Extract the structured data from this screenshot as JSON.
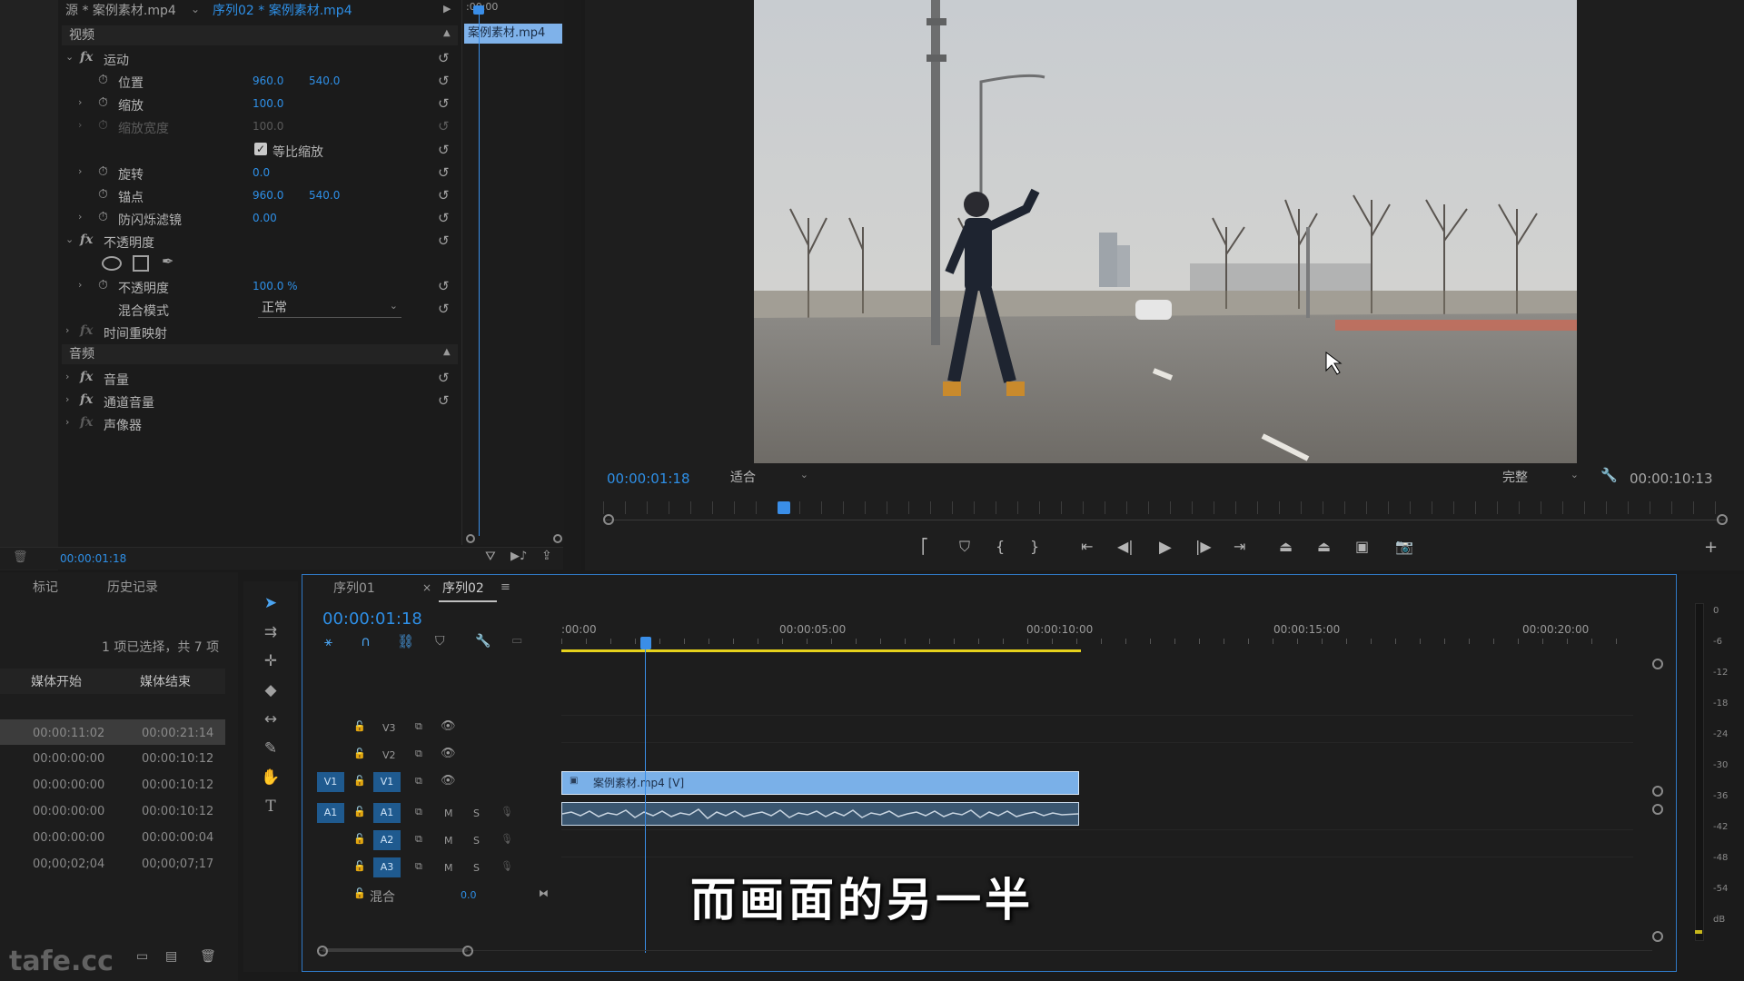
{
  "source_tab": {
    "label": "源 * 案例素材.mp4",
    "sequence_label": "序列02 * 案例素材.mp4",
    "mini_clip": "案例素材.mp4",
    "mini_time": ":00:00"
  },
  "effects": {
    "video_header": "视频",
    "motion": "运动",
    "position": {
      "label": "位置",
      "x": "960.0",
      "y": "540.0"
    },
    "scale": {
      "label": "缩放",
      "value": "100.0"
    },
    "scale_width": {
      "label": "缩放宽度",
      "value": "100.0"
    },
    "uniform_scale": "等比缩放",
    "rotation": {
      "label": "旋转",
      "value": "0.0"
    },
    "anchor": {
      "label": "锚点",
      "x": "960.0",
      "y": "540.0"
    },
    "antiflicker": {
      "label": "防闪烁滤镜",
      "value": "0.00"
    },
    "opacity_group": "不透明度",
    "opacity": {
      "label": "不透明度",
      "value": "100.0 %"
    },
    "blend_mode": {
      "label": "混合模式",
      "value": "正常"
    },
    "time_remap": "时间重映射",
    "audio_header": "音频",
    "volume": "音量",
    "channel_volume": "通道音量",
    "panner": "声像器",
    "timecode": "00:00:01:18"
  },
  "program": {
    "timecode": "00:00:01:18",
    "fit": "适合",
    "quality": "完整",
    "duration": "00:00:10:13"
  },
  "project": {
    "tab_markers": "标记",
    "tab_history": "历史记录",
    "selection_info": "1 项已选择，共 7 项",
    "col_start": "媒体开始",
    "col_end": "媒体结束",
    "rows": [
      {
        "start": "00:00:11:02",
        "end": "00:00:21:14"
      },
      {
        "start": "00:00:00:00",
        "end": "00:00:10:12"
      },
      {
        "start": "00:00:00:00",
        "end": "00:00:10:12"
      },
      {
        "start": "00:00:00:00",
        "end": "00:00:10:12"
      },
      {
        "start": "00:00:00:00",
        "end": "00:00:00:04"
      },
      {
        "start": "00;00;02;04",
        "end": "00;00;07;17"
      }
    ],
    "watermark": "tafe.cc"
  },
  "timeline": {
    "tab1": "序列01",
    "tab2": "序列02",
    "timecode": "00:00:01:18",
    "ruler": [
      ":00:00",
      "00:00:05:00",
      "00:00:10:00",
      "00:00:15:00",
      "00:00:20:00"
    ],
    "tracks_video": [
      "V3",
      "V2",
      "V1"
    ],
    "tracks_audio": [
      "A1",
      "A2",
      "A3"
    ],
    "source_v": "V1",
    "source_a": "A1",
    "mix_label": "混合",
    "mix_value": "0.0",
    "clip_video": "案例素材.mp4 [V]",
    "mute": "M",
    "solo": "S"
  },
  "meter": {
    "scale": [
      "0",
      "-6",
      "-12",
      "-18",
      "-24",
      "-30",
      "-36",
      "-42",
      "-48",
      "-54",
      "dB"
    ]
  },
  "subtitle": "而画面的另一半"
}
